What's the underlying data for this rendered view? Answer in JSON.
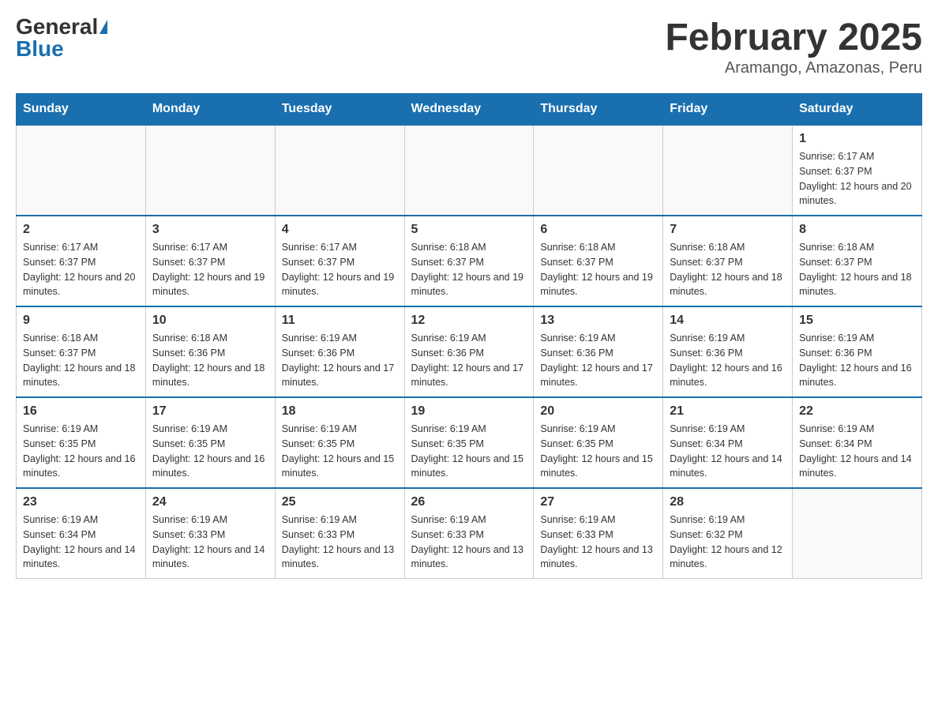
{
  "logo": {
    "general": "General",
    "blue": "Blue"
  },
  "title": "February 2025",
  "location": "Aramango, Amazonas, Peru",
  "days_of_week": [
    "Sunday",
    "Monday",
    "Tuesday",
    "Wednesday",
    "Thursday",
    "Friday",
    "Saturday"
  ],
  "weeks": [
    [
      {
        "day": "",
        "info": ""
      },
      {
        "day": "",
        "info": ""
      },
      {
        "day": "",
        "info": ""
      },
      {
        "day": "",
        "info": ""
      },
      {
        "day": "",
        "info": ""
      },
      {
        "day": "",
        "info": ""
      },
      {
        "day": "1",
        "info": "Sunrise: 6:17 AM\nSunset: 6:37 PM\nDaylight: 12 hours and 20 minutes."
      }
    ],
    [
      {
        "day": "2",
        "info": "Sunrise: 6:17 AM\nSunset: 6:37 PM\nDaylight: 12 hours and 20 minutes."
      },
      {
        "day": "3",
        "info": "Sunrise: 6:17 AM\nSunset: 6:37 PM\nDaylight: 12 hours and 19 minutes."
      },
      {
        "day": "4",
        "info": "Sunrise: 6:17 AM\nSunset: 6:37 PM\nDaylight: 12 hours and 19 minutes."
      },
      {
        "day": "5",
        "info": "Sunrise: 6:18 AM\nSunset: 6:37 PM\nDaylight: 12 hours and 19 minutes."
      },
      {
        "day": "6",
        "info": "Sunrise: 6:18 AM\nSunset: 6:37 PM\nDaylight: 12 hours and 19 minutes."
      },
      {
        "day": "7",
        "info": "Sunrise: 6:18 AM\nSunset: 6:37 PM\nDaylight: 12 hours and 18 minutes."
      },
      {
        "day": "8",
        "info": "Sunrise: 6:18 AM\nSunset: 6:37 PM\nDaylight: 12 hours and 18 minutes."
      }
    ],
    [
      {
        "day": "9",
        "info": "Sunrise: 6:18 AM\nSunset: 6:37 PM\nDaylight: 12 hours and 18 minutes."
      },
      {
        "day": "10",
        "info": "Sunrise: 6:18 AM\nSunset: 6:36 PM\nDaylight: 12 hours and 18 minutes."
      },
      {
        "day": "11",
        "info": "Sunrise: 6:19 AM\nSunset: 6:36 PM\nDaylight: 12 hours and 17 minutes."
      },
      {
        "day": "12",
        "info": "Sunrise: 6:19 AM\nSunset: 6:36 PM\nDaylight: 12 hours and 17 minutes."
      },
      {
        "day": "13",
        "info": "Sunrise: 6:19 AM\nSunset: 6:36 PM\nDaylight: 12 hours and 17 minutes."
      },
      {
        "day": "14",
        "info": "Sunrise: 6:19 AM\nSunset: 6:36 PM\nDaylight: 12 hours and 16 minutes."
      },
      {
        "day": "15",
        "info": "Sunrise: 6:19 AM\nSunset: 6:36 PM\nDaylight: 12 hours and 16 minutes."
      }
    ],
    [
      {
        "day": "16",
        "info": "Sunrise: 6:19 AM\nSunset: 6:35 PM\nDaylight: 12 hours and 16 minutes."
      },
      {
        "day": "17",
        "info": "Sunrise: 6:19 AM\nSunset: 6:35 PM\nDaylight: 12 hours and 16 minutes."
      },
      {
        "day": "18",
        "info": "Sunrise: 6:19 AM\nSunset: 6:35 PM\nDaylight: 12 hours and 15 minutes."
      },
      {
        "day": "19",
        "info": "Sunrise: 6:19 AM\nSunset: 6:35 PM\nDaylight: 12 hours and 15 minutes."
      },
      {
        "day": "20",
        "info": "Sunrise: 6:19 AM\nSunset: 6:35 PM\nDaylight: 12 hours and 15 minutes."
      },
      {
        "day": "21",
        "info": "Sunrise: 6:19 AM\nSunset: 6:34 PM\nDaylight: 12 hours and 14 minutes."
      },
      {
        "day": "22",
        "info": "Sunrise: 6:19 AM\nSunset: 6:34 PM\nDaylight: 12 hours and 14 minutes."
      }
    ],
    [
      {
        "day": "23",
        "info": "Sunrise: 6:19 AM\nSunset: 6:34 PM\nDaylight: 12 hours and 14 minutes."
      },
      {
        "day": "24",
        "info": "Sunrise: 6:19 AM\nSunset: 6:33 PM\nDaylight: 12 hours and 14 minutes."
      },
      {
        "day": "25",
        "info": "Sunrise: 6:19 AM\nSunset: 6:33 PM\nDaylight: 12 hours and 13 minutes."
      },
      {
        "day": "26",
        "info": "Sunrise: 6:19 AM\nSunset: 6:33 PM\nDaylight: 12 hours and 13 minutes."
      },
      {
        "day": "27",
        "info": "Sunrise: 6:19 AM\nSunset: 6:33 PM\nDaylight: 12 hours and 13 minutes."
      },
      {
        "day": "28",
        "info": "Sunrise: 6:19 AM\nSunset: 6:32 PM\nDaylight: 12 hours and 12 minutes."
      },
      {
        "day": "",
        "info": ""
      }
    ]
  ]
}
